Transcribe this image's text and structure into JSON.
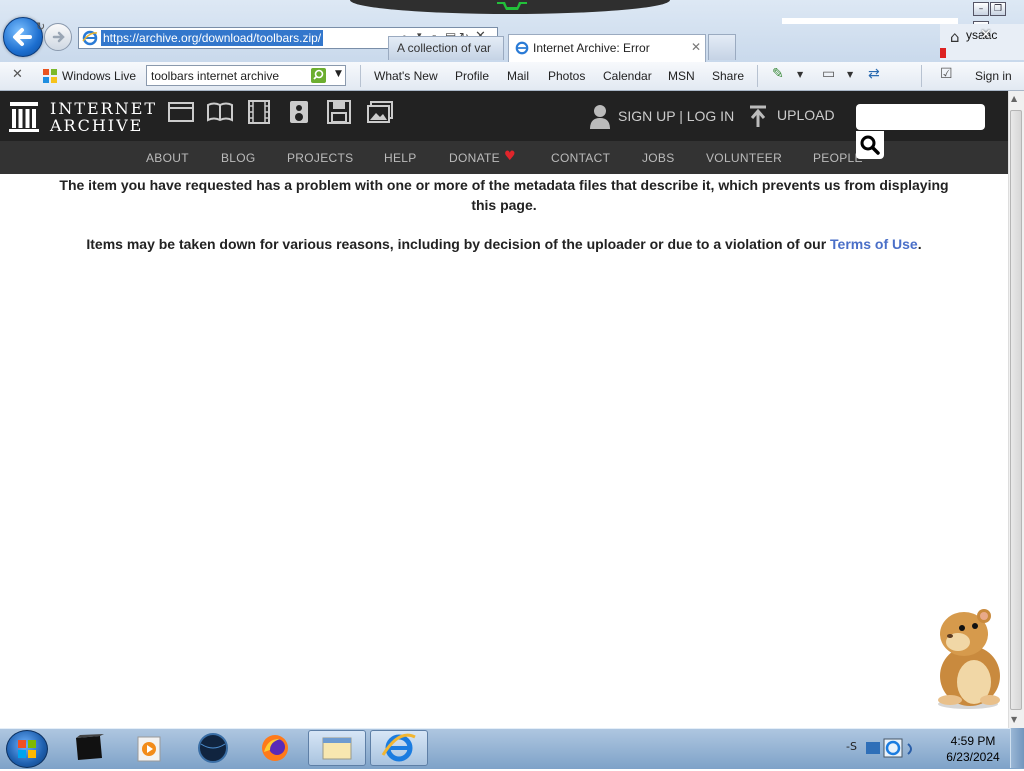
{
  "browser": {
    "url": "https://archive.org/download/toolbars.zip/",
    "tabs": [
      {
        "label": "A collection of var",
        "active": false
      },
      {
        "label": "Internet Archive: Error",
        "active": true
      }
    ],
    "right_partial_text": "ysaac"
  },
  "live_toolbar": {
    "brand": "Windows Live",
    "search_value": "toolbars internet archive",
    "links": [
      "What's New",
      "Profile",
      "Mail",
      "Photos",
      "Calendar",
      "MSN",
      "Share"
    ],
    "sign_in": "Sign in"
  },
  "ia": {
    "logo_line1": "INTERNET",
    "logo_line2": "ARCHIVE",
    "media_icons": [
      "web-icon",
      "texts-icon",
      "video-icon",
      "audio-icon",
      "software-icon",
      "images-icon"
    ],
    "signup_login": "SIGN UP | LOG IN",
    "upload": "UPLOAD",
    "nav": [
      "ABOUT",
      "BLOG",
      "PROJECTS",
      "HELP",
      "DONATE",
      "CONTACT",
      "JOBS",
      "VOLUNTEER",
      "PEOPLE"
    ]
  },
  "content": {
    "error_line1": "The item you have requested has a problem with one or more of the metadata files that describe it, which prevents us from displaying this page.",
    "takedown_prefix": "Items may be taken down for various reasons, including by decision of the uploader or due to a violation of our ",
    "terms_link": "Terms of Use",
    "takedown_suffix": "."
  },
  "taskbar": {
    "clock_time": "4:59 PM",
    "clock_date": "6/23/2024"
  },
  "colors": {
    "ia_header": "#222222",
    "ia_nav": "#333333",
    "link_blue": "#4a6fc8",
    "donate_heart": "#e0252b"
  }
}
